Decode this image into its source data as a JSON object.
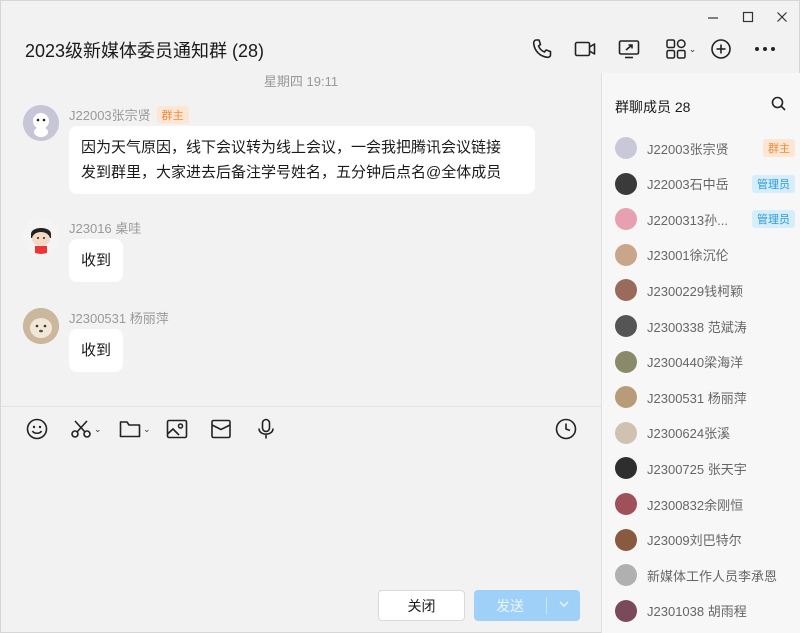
{
  "window": {
    "title": "2023级新媒体委员通知群 (28)"
  },
  "chat": {
    "date_separator": "星期四 19:11",
    "messages": [
      {
        "sender": "J22003张宗贤",
        "role": "群主",
        "text_lines": [
          "因为天气原因，线下会议转为线上会议，一会我把腾讯会议链接",
          "发到群里，大家进去后备注学号姓名，五分钟后点名@全体成员"
        ]
      },
      {
        "sender": "J23016 桌哇",
        "role": "",
        "text_lines": [
          "收到"
        ]
      },
      {
        "sender": "J2300531 杨丽萍",
        "role": "",
        "text_lines": [
          "收到"
        ]
      }
    ]
  },
  "buttons": {
    "close": "关闭",
    "send": "发送",
    "send_dropdown": "⌄"
  },
  "panel": {
    "title": "群聊成员 28",
    "members": [
      {
        "name": "J22003张宗贤",
        "badge": "群主",
        "badge_type": "owner",
        "avatar_color": "#c8c8d8"
      },
      {
        "name": "J22003石中岳",
        "badge": "管理员",
        "badge_type": "admin",
        "avatar_color": "#3a3a3a"
      },
      {
        "name": "J2200313孙...",
        "badge": "管理员",
        "badge_type": "admin",
        "avatar_color": "#e7a0b0"
      },
      {
        "name": "J23001徐沉伦",
        "badge": "",
        "badge_type": "",
        "avatar_color": "#c9a58a"
      },
      {
        "name": "J2300229钱柯颖",
        "badge": "",
        "badge_type": "",
        "avatar_color": "#9b6a5a"
      },
      {
        "name": "J2300338 范斌涛",
        "badge": "",
        "badge_type": "",
        "avatar_color": "#555555"
      },
      {
        "name": "J2300440梁海洋",
        "badge": "",
        "badge_type": "",
        "avatar_color": "#8a8a6a"
      },
      {
        "name": "J2300531 杨丽萍",
        "badge": "",
        "badge_type": "",
        "avatar_color": "#b89c7a"
      },
      {
        "name": "J2300624张溪",
        "badge": "",
        "badge_type": "",
        "avatar_color": "#cfc2b0"
      },
      {
        "name": "J2300725 张天宇",
        "badge": "",
        "badge_type": "",
        "avatar_color": "#2e2e2e"
      },
      {
        "name": "J2300832余刚恒",
        "badge": "",
        "badge_type": "",
        "avatar_color": "#a0505a"
      },
      {
        "name": "J23009刘巴特尔",
        "badge": "",
        "badge_type": "",
        "avatar_color": "#8a5a40"
      },
      {
        "name": "新媒体工作人员李承恩",
        "badge": "",
        "badge_type": "",
        "avatar_color": "#b0b0b0"
      },
      {
        "name": "J2301038 胡雨程",
        "badge": "",
        "badge_type": "",
        "avatar_color": "#7a4a5a"
      }
    ]
  },
  "colors": {
    "owner_badge_bg": "#fde6d3",
    "owner_badge_fg": "#f08a3c",
    "admin_badge_bg": "#d6eefb",
    "admin_badge_fg": "#2c9ad8",
    "send_button": "#9fd0f7"
  },
  "icons": {
    "header": [
      "phone-icon",
      "video-icon",
      "screen-share-icon",
      "apps-icon",
      "add-member-icon",
      "more-icon"
    ],
    "toolbar": [
      "emoji-icon",
      "scissors-icon",
      "folder-icon",
      "image-icon",
      "red-packet-icon",
      "microphone-icon",
      "history-icon"
    ]
  }
}
